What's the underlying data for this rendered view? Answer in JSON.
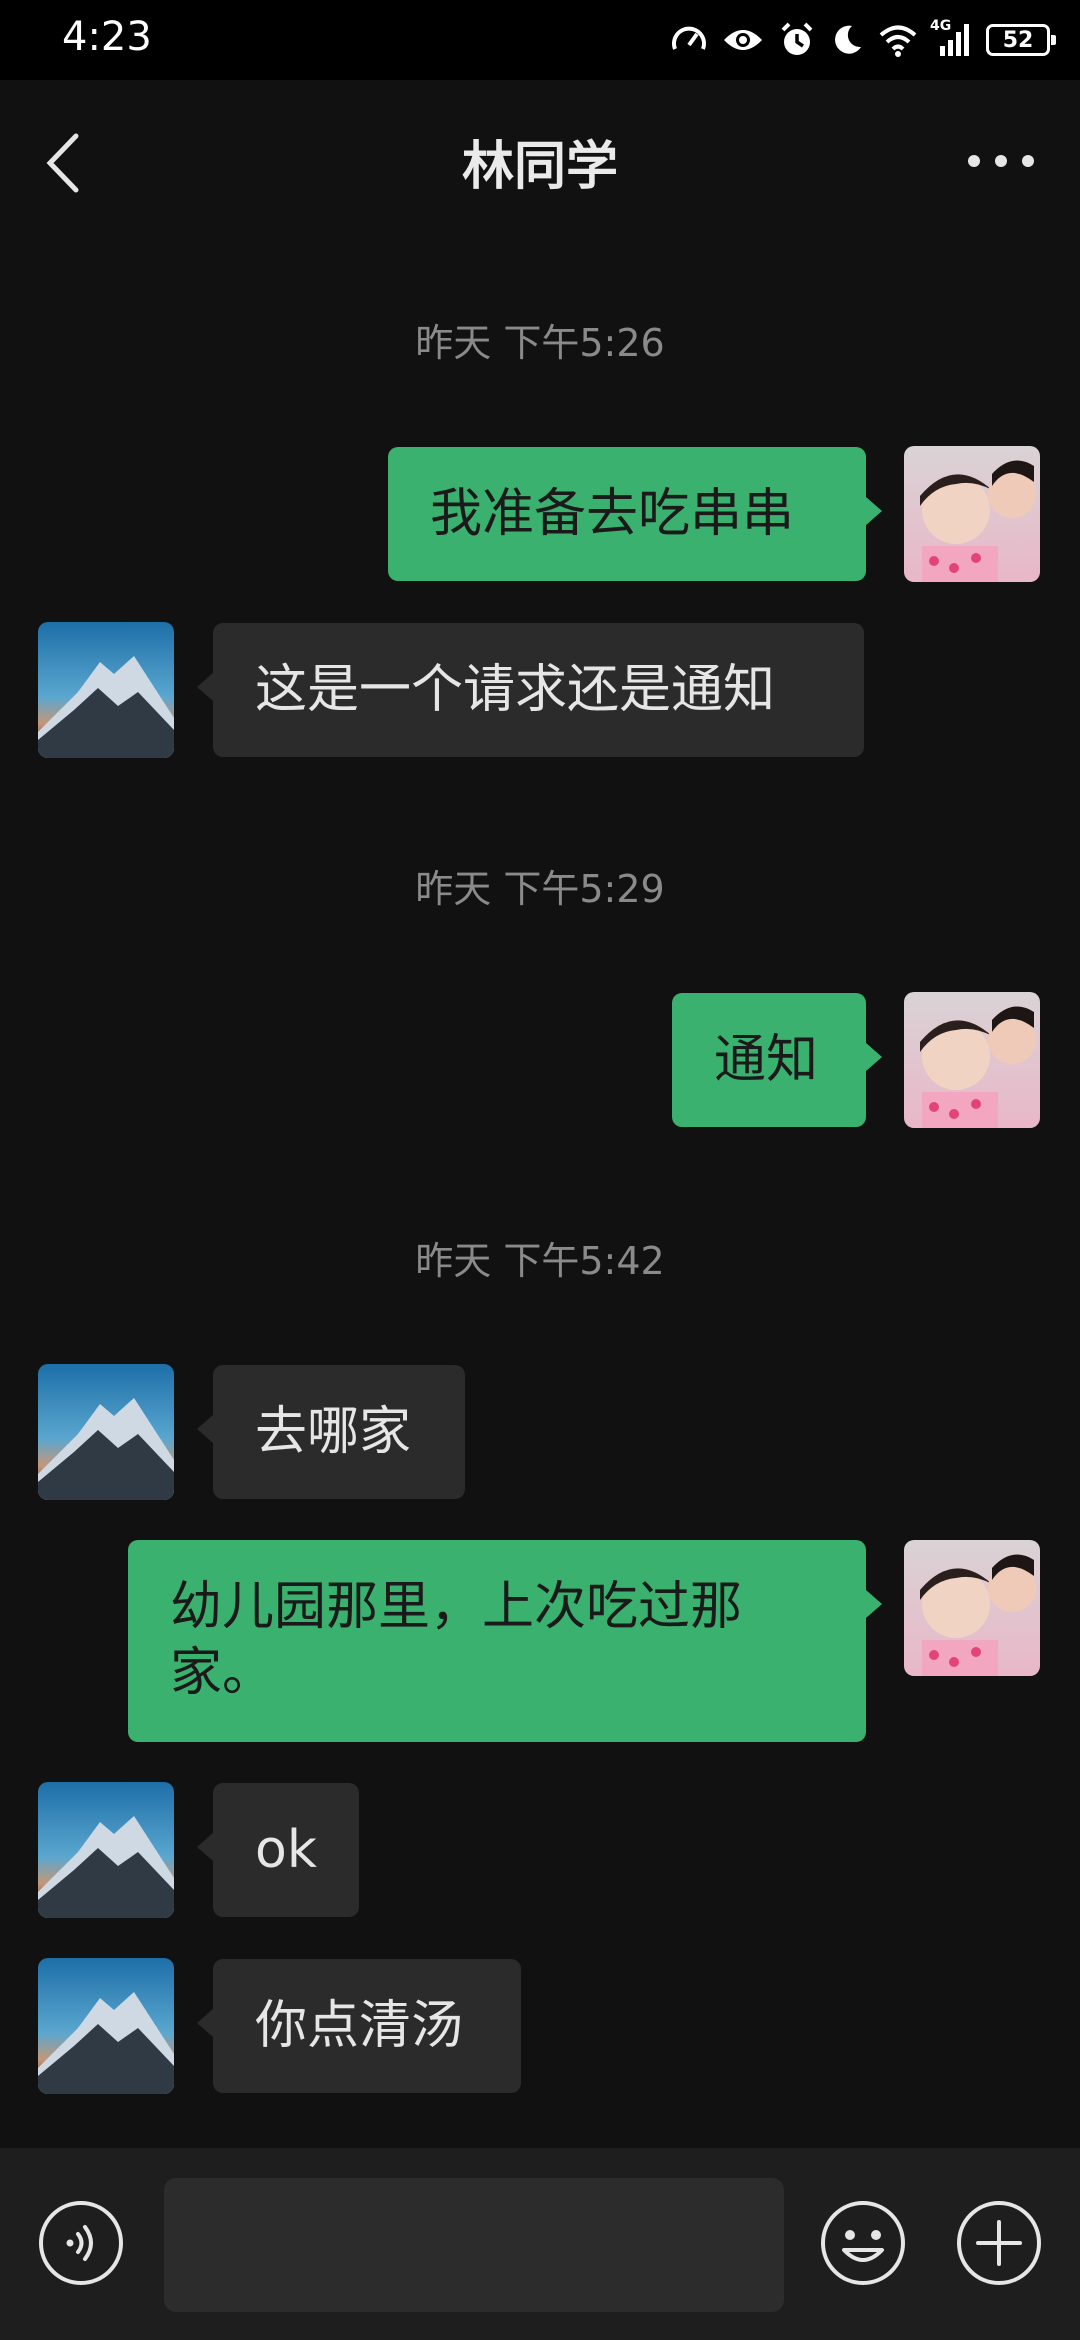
{
  "status_bar": {
    "time": "4:23",
    "network": "4G",
    "battery": "52"
  },
  "header": {
    "title": "林同学"
  },
  "messages": [
    {
      "type": "timestamp",
      "text": "昨天 下午5:26"
    },
    {
      "type": "sent",
      "text": "我准备去吃串串"
    },
    {
      "type": "received",
      "text": "这是一个请求还是通知"
    },
    {
      "type": "timestamp",
      "text": "昨天 下午5:29"
    },
    {
      "type": "sent",
      "text": "通知"
    },
    {
      "type": "timestamp",
      "text": "昨天 下午5:42"
    },
    {
      "type": "received",
      "text": "去哪家"
    },
    {
      "type": "sent",
      "text": "幼儿园那里，上次吃过那家。"
    },
    {
      "type": "received",
      "text": "ok"
    },
    {
      "type": "received",
      "text": "你点清汤"
    }
  ],
  "input_bar": {
    "value": "",
    "icons": [
      "voice-icon",
      "emoji-icon",
      "plus-icon"
    ]
  },
  "colors": {
    "sent_bubble": "#3bb16f",
    "received_bubble": "#2b2b2b",
    "background": "#111111"
  }
}
